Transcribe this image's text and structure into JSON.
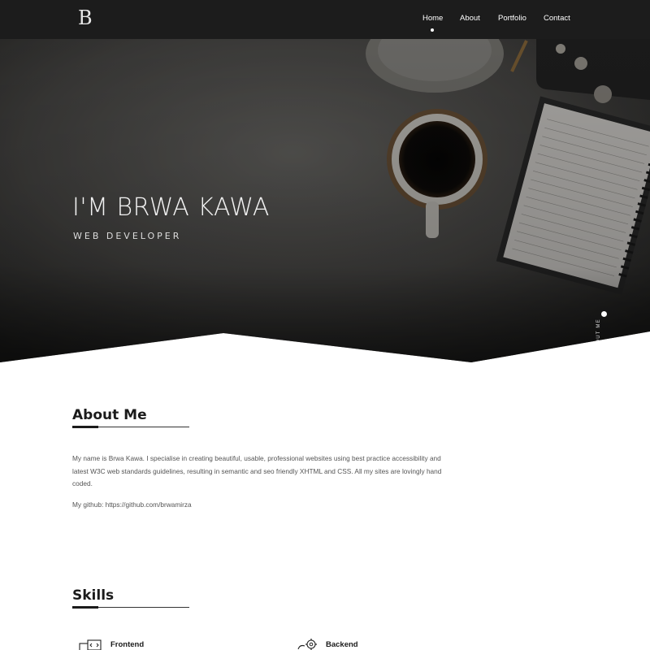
{
  "nav": {
    "logo": "B",
    "links": [
      {
        "label": "Home",
        "active": true
      },
      {
        "label": "About",
        "active": false
      },
      {
        "label": "Portfolio",
        "active": false
      },
      {
        "label": "Contact",
        "active": false
      }
    ]
  },
  "hero": {
    "title": "I'M BRWA KAWA",
    "subtitle": "WEB DEVELOPER",
    "scroll_label": "ABOUT ME"
  },
  "about": {
    "title": "About Me",
    "paragraphs": [
      "My name is Brwa Kawa. I specialise in creating beautiful, usable, professional websites using best practice accessibility and latest W3C web standards guidelines, resulting in semantic and seo friendly XHTML and CSS. All my sites are lovingly hand coded.",
      "My github: https://github.com/brwamirza"
    ]
  },
  "skills": {
    "title": "Skills",
    "items": [
      {
        "label": "Frontend",
        "icon": "monitor-code-icon"
      },
      {
        "label": "Backend",
        "icon": "server-gear-icon"
      }
    ]
  },
  "colors": {
    "navbar_bg": "#1c1c1c",
    "text_dark": "#1b1b1b",
    "text_body": "#555555"
  }
}
